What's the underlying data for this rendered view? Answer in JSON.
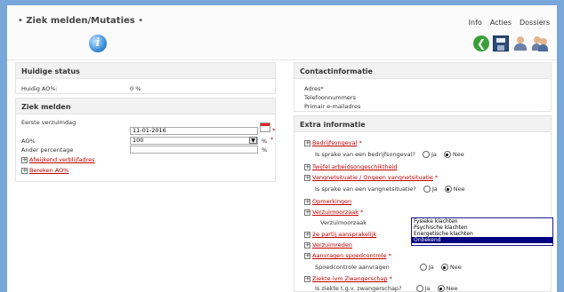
{
  "header": {
    "title": "Ziek melden/Mutaties",
    "title_dot": "•",
    "menu": [
      "Info",
      "Acties",
      "Dossiers"
    ]
  },
  "status": {
    "heading": "Huidige status",
    "ao_label": "Huidig AO%:",
    "ao_value": "0 %"
  },
  "ziek": {
    "heading": "Ziek melden",
    "first_day_label": "Eerste verzuimdag",
    "first_day_value": "11-01-2016",
    "ao_label": "AO%",
    "ao_value": "100",
    "other_pct_label": "Ander percentage",
    "pct": "%",
    "link1": "Afwijkend verblijfadres",
    "link2": "Bereken AO%"
  },
  "contact": {
    "heading": "Contactinformatie",
    "lines": [
      "Adres*",
      "Telefoonnummers",
      "Primair e-mailadres"
    ]
  },
  "extra": {
    "heading": "Extra informatie",
    "items": {
      "bedrijfsongeval": "Bedrijfsongeval",
      "bedrijfsongeval_q": "Is sprake van een bedrijfsongeval?",
      "twijfel": "Twijfel arbeidsongeschiktheid",
      "vangnet": "Vangnetsituatie / Ongeen vangnetsituatie",
      "vangnet_q": "Is sprake van een vangnetsituatie?",
      "opmerkingen": "Opmerkingen",
      "verzuimoorzaak": "Verzuimoorzaak",
      "verzuimoorzaak_label": "Verzuimoorzaak",
      "derde": "2e partij aansprakelijk",
      "verzuimreden": "Verzuimreden",
      "spoed": "Aanvragen spoedcontrole",
      "spoed_q": "Spoedcontrole aanvragen",
      "zwanger": "Ziekte ivm Zwangerschap",
      "zwanger_q": "Is ziekte t.g.v. zwangerschap?"
    },
    "yes": "Ja",
    "no": "Nee",
    "options": [
      "Fysieke klachten",
      "Psychische klachten",
      "Energetische klachten",
      "Onbekend"
    ],
    "selected_option": "Onbekend"
  }
}
